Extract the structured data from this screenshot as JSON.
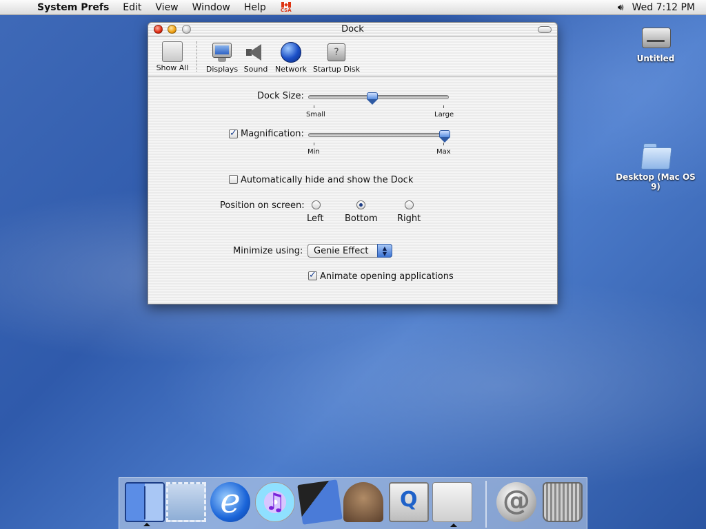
{
  "menubar": {
    "app_name": "System Prefs",
    "menus": [
      "Edit",
      "View",
      "Window",
      "Help"
    ],
    "flag_text": "CSA",
    "clock": "Wed 7:12 PM"
  },
  "desktop": {
    "icons": [
      {
        "label": "Untitled"
      },
      {
        "label": "Desktop (Mac OS 9)"
      }
    ]
  },
  "window": {
    "title": "Dock",
    "toolbar": [
      "Show All",
      "Displays",
      "Sound",
      "Network",
      "Startup Disk"
    ]
  },
  "dock_prefs": {
    "dock_size_label": "Dock Size:",
    "dock_size_min": "Small",
    "dock_size_max": "Large",
    "dock_size_value": 0.43,
    "magnification_label": "Magnification:",
    "magnification_checked": true,
    "magnification_min": "Min",
    "magnification_max": "Max",
    "magnification_value": 1.0,
    "autohide_label": "Automatically hide and show the Dock",
    "autohide_checked": false,
    "position_label": "Position on screen:",
    "position_options": [
      "Left",
      "Bottom",
      "Right"
    ],
    "position_selected": "Bottom",
    "minimize_label": "Minimize using:",
    "minimize_value": "Genie Effect",
    "animate_label": "Animate opening applications",
    "animate_checked": true
  },
  "dock_apps": [
    "finder-icon",
    "mail-icon",
    "internet-explorer-icon",
    "itunes-icon",
    "imovie-icon",
    "sherlock-icon",
    "quicktime-icon",
    "system-preferences-icon",
    "mail-drop-icon",
    "trash-icon"
  ]
}
